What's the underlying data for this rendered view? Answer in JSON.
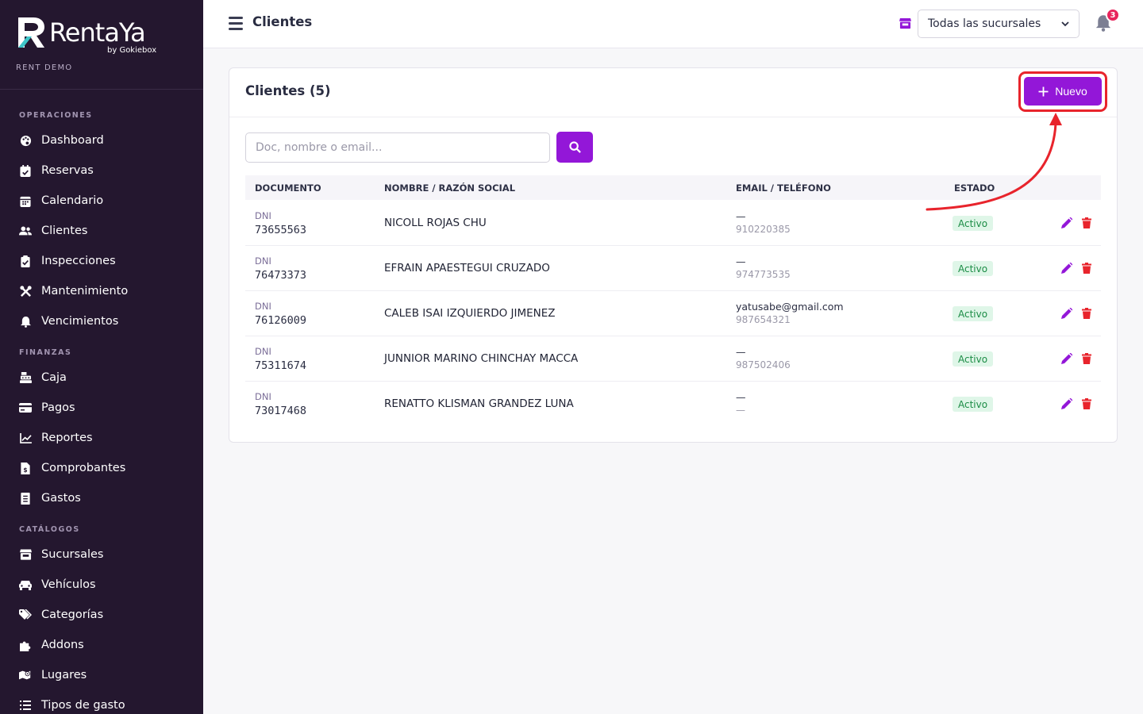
{
  "sidebar": {
    "brand_name": "RentaYa",
    "brand_by": "by Gokiebox",
    "brand_sub": "RENT DEMO",
    "sections": [
      {
        "title": "OPERACIONES"
      },
      {
        "title": "FINANZAS"
      },
      {
        "title": "CATÁLOGOS"
      }
    ],
    "items": [
      {
        "label": "Dashboard",
        "icon": "palette-icon"
      },
      {
        "label": "Reservas",
        "icon": "calendar-check-icon"
      },
      {
        "label": "Calendario",
        "icon": "calendar-icon"
      },
      {
        "label": "Clientes",
        "icon": "users-icon"
      },
      {
        "label": "Inspecciones",
        "icon": "clipboard-check-icon"
      },
      {
        "label": "Mantenimiento",
        "icon": "tools-icon"
      },
      {
        "label": "Vencimientos",
        "icon": "bell-icon"
      },
      {
        "label": "Caja",
        "icon": "cash-register-icon"
      },
      {
        "label": "Pagos",
        "icon": "credit-card-icon"
      },
      {
        "label": "Reportes",
        "icon": "chart-line-icon"
      },
      {
        "label": "Comprobantes",
        "icon": "invoice-icon"
      },
      {
        "label": "Gastos",
        "icon": "receipt-icon"
      },
      {
        "label": "Sucursales",
        "icon": "store-icon"
      },
      {
        "label": "Vehículos",
        "icon": "car-icon"
      },
      {
        "label": "Categorías",
        "icon": "tags-icon"
      },
      {
        "label": "Addons",
        "icon": "puzzle-icon"
      },
      {
        "label": "Lugares",
        "icon": "map-icon"
      },
      {
        "label": "Tipos de gasto",
        "icon": "list-icon"
      }
    ]
  },
  "topbar": {
    "title": "Clientes",
    "branch_select": "Todas las sucursales",
    "notification_count": "3"
  },
  "card": {
    "title": "Clientes (5)",
    "new_label": "Nuevo",
    "search_placeholder": "Doc, nombre o email...",
    "columns": [
      "DOCUMENTO",
      "NOMBRE / RAZÓN SOCIAL",
      "EMAIL / TELÉFONO",
      "ESTADO"
    ],
    "rows": [
      {
        "doc_type": "DNI",
        "doc": "73655563",
        "name": "NICOLL ROJAS CHU",
        "email": "—",
        "phone": "910220385",
        "status": "Activo"
      },
      {
        "doc_type": "DNI",
        "doc": "76473373",
        "name": "EFRAIN APAESTEGUI CRUZADO",
        "email": "—",
        "phone": "974773535",
        "status": "Activo"
      },
      {
        "doc_type": "DNI",
        "doc": "76126009",
        "name": "CALEB ISAI IZQUIERDO JIMENEZ",
        "email": "yatusabe@gmail.com",
        "phone": "987654321",
        "status": "Activo"
      },
      {
        "doc_type": "DNI",
        "doc": "75311674",
        "name": "JUNNIOR MARINO CHINCHAY MACCA",
        "email": "—",
        "phone": "987502406",
        "status": "Activo"
      },
      {
        "doc_type": "DNI",
        "doc": "73017468",
        "name": "RENATTO KLISMAN GRANDEZ LUNA",
        "email": "—",
        "phone": "—",
        "status": "Activo"
      }
    ]
  },
  "colors": {
    "sidebar_bg": "#24172f",
    "primary": "#9317d8",
    "danger": "#e8242c",
    "success_text": "#1b8c45",
    "success_bg": "#dff6e8"
  }
}
